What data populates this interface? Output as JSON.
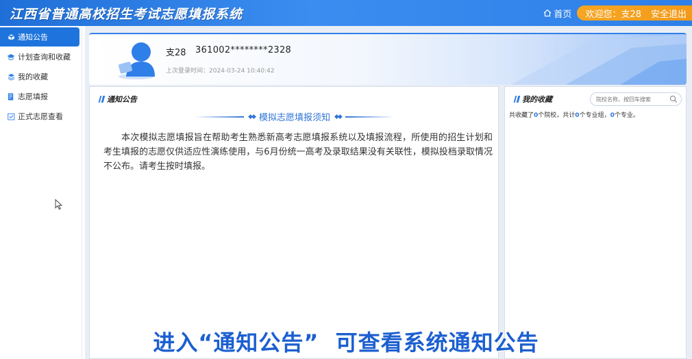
{
  "header": {
    "title": "江西省普通高校招生考试志愿填报系统",
    "home_label": "首页",
    "welcome": "欢迎您：支28",
    "logout": "安全退出"
  },
  "sidebar": {
    "items": [
      {
        "label": "通知公告",
        "icon": "cube-icon",
        "active": true
      },
      {
        "label": "计划查询和收藏",
        "icon": "graduation-cap-icon"
      },
      {
        "label": "我的收藏",
        "icon": "layers-icon"
      },
      {
        "label": "志愿填报",
        "icon": "edit-document-icon"
      },
      {
        "label": "正式志愿查看",
        "icon": "checklist-icon"
      }
    ]
  },
  "profile": {
    "name": "支28",
    "id_masked": "361002********2328",
    "last_login": "上次登录时间：2024-03-24 10:40:42"
  },
  "notice": {
    "panel_title": "通知公告",
    "heading": "模拟志愿填报须知",
    "body": "本次模拟志愿填报旨在帮助考生熟悉新高考志愿填报系统以及填报流程，所使用的招生计划和考生填报的志愿仅供适应性演练使用，与6月份统一高考及录取结果没有关联性，模拟投档录取情况不公布。请考生按时填报。"
  },
  "favorites": {
    "panel_title": "我的收藏",
    "search_placeholder": "院校名称、按回车搜索",
    "summary_prefix": "共收藏了",
    "school_count": "0",
    "schools_text": "个院校，共计",
    "group_count": "0",
    "groups_text": "个专业组，",
    "major_count": "0",
    "majors_text": "个专业。"
  },
  "caption": "进入“通知公告”  可查看系统通知公告",
  "colors": {
    "primary": "#1e74dc",
    "accent_orange": "#f6a623",
    "caption": "#1c5fd0"
  }
}
